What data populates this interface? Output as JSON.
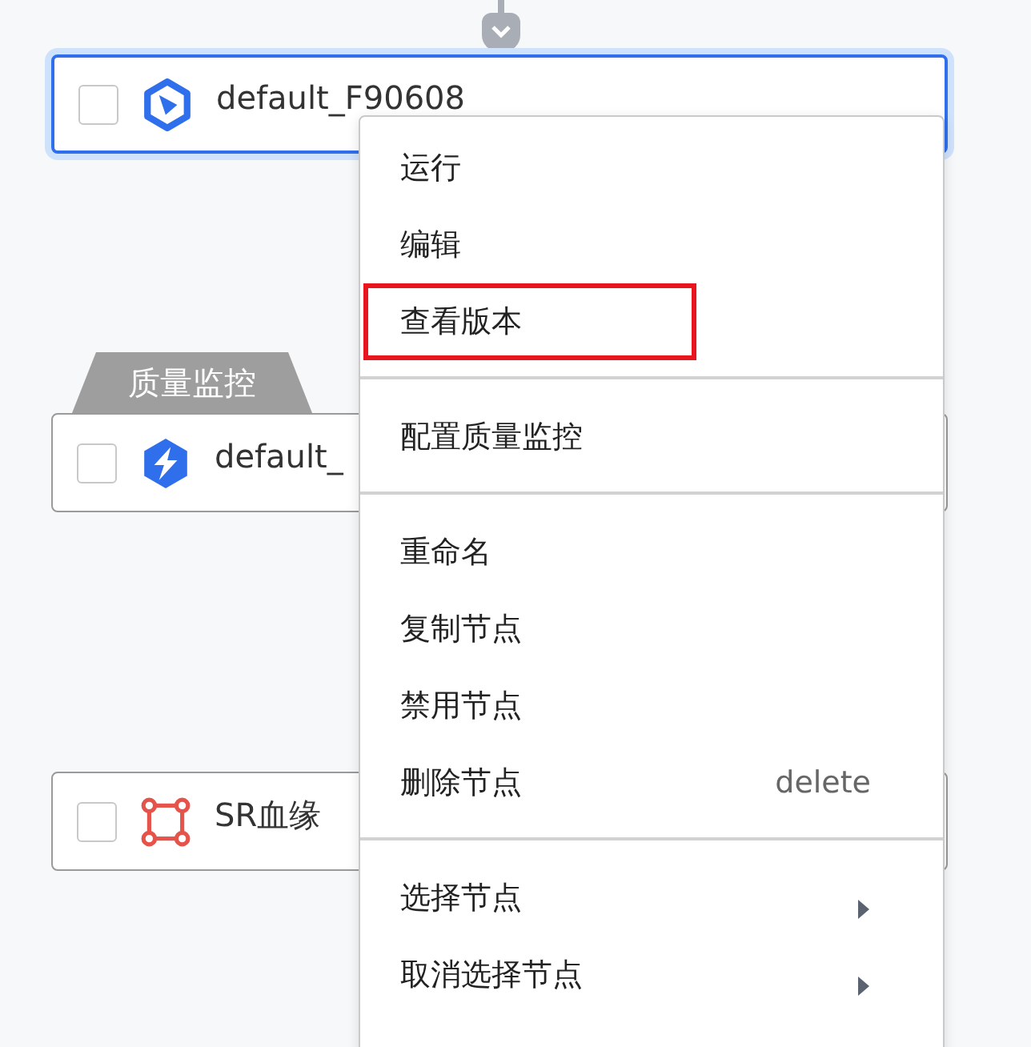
{
  "nodes": [
    {
      "name": "default_F90608",
      "kind": "task",
      "selected": true,
      "checked": false
    },
    {
      "name": "default_",
      "kind": "quality",
      "selected": false,
      "checked": false,
      "tabs": [
        {
          "label": "质量监控"
        }
      ]
    },
    {
      "name": "SR血缘",
      "kind": "lineage",
      "selected": false,
      "checked": false
    }
  ],
  "context_menu": {
    "groups": [
      {
        "items": [
          {
            "label": "运行",
            "highlighted": false,
            "submenu": false
          },
          {
            "label": "编辑",
            "highlighted": false,
            "submenu": false
          },
          {
            "label": "查看版本",
            "highlighted": true,
            "submenu": false
          }
        ]
      },
      {
        "items": [
          {
            "label": "配置质量监控",
            "highlighted": false,
            "submenu": false
          }
        ]
      },
      {
        "items": [
          {
            "label": "重命名",
            "highlighted": false,
            "submenu": false
          },
          {
            "label": "复制节点",
            "highlighted": false,
            "submenu": false
          },
          {
            "label": "禁用节点",
            "highlighted": false,
            "submenu": false
          },
          {
            "label": "删除节点",
            "shortcut": "delete",
            "highlighted": false,
            "submenu": false
          }
        ]
      },
      {
        "items": [
          {
            "label": "选择节点",
            "highlighted": false,
            "submenu": true
          },
          {
            "label": "取消选择节点",
            "highlighted": false,
            "submenu": true
          }
        ]
      }
    ]
  }
}
